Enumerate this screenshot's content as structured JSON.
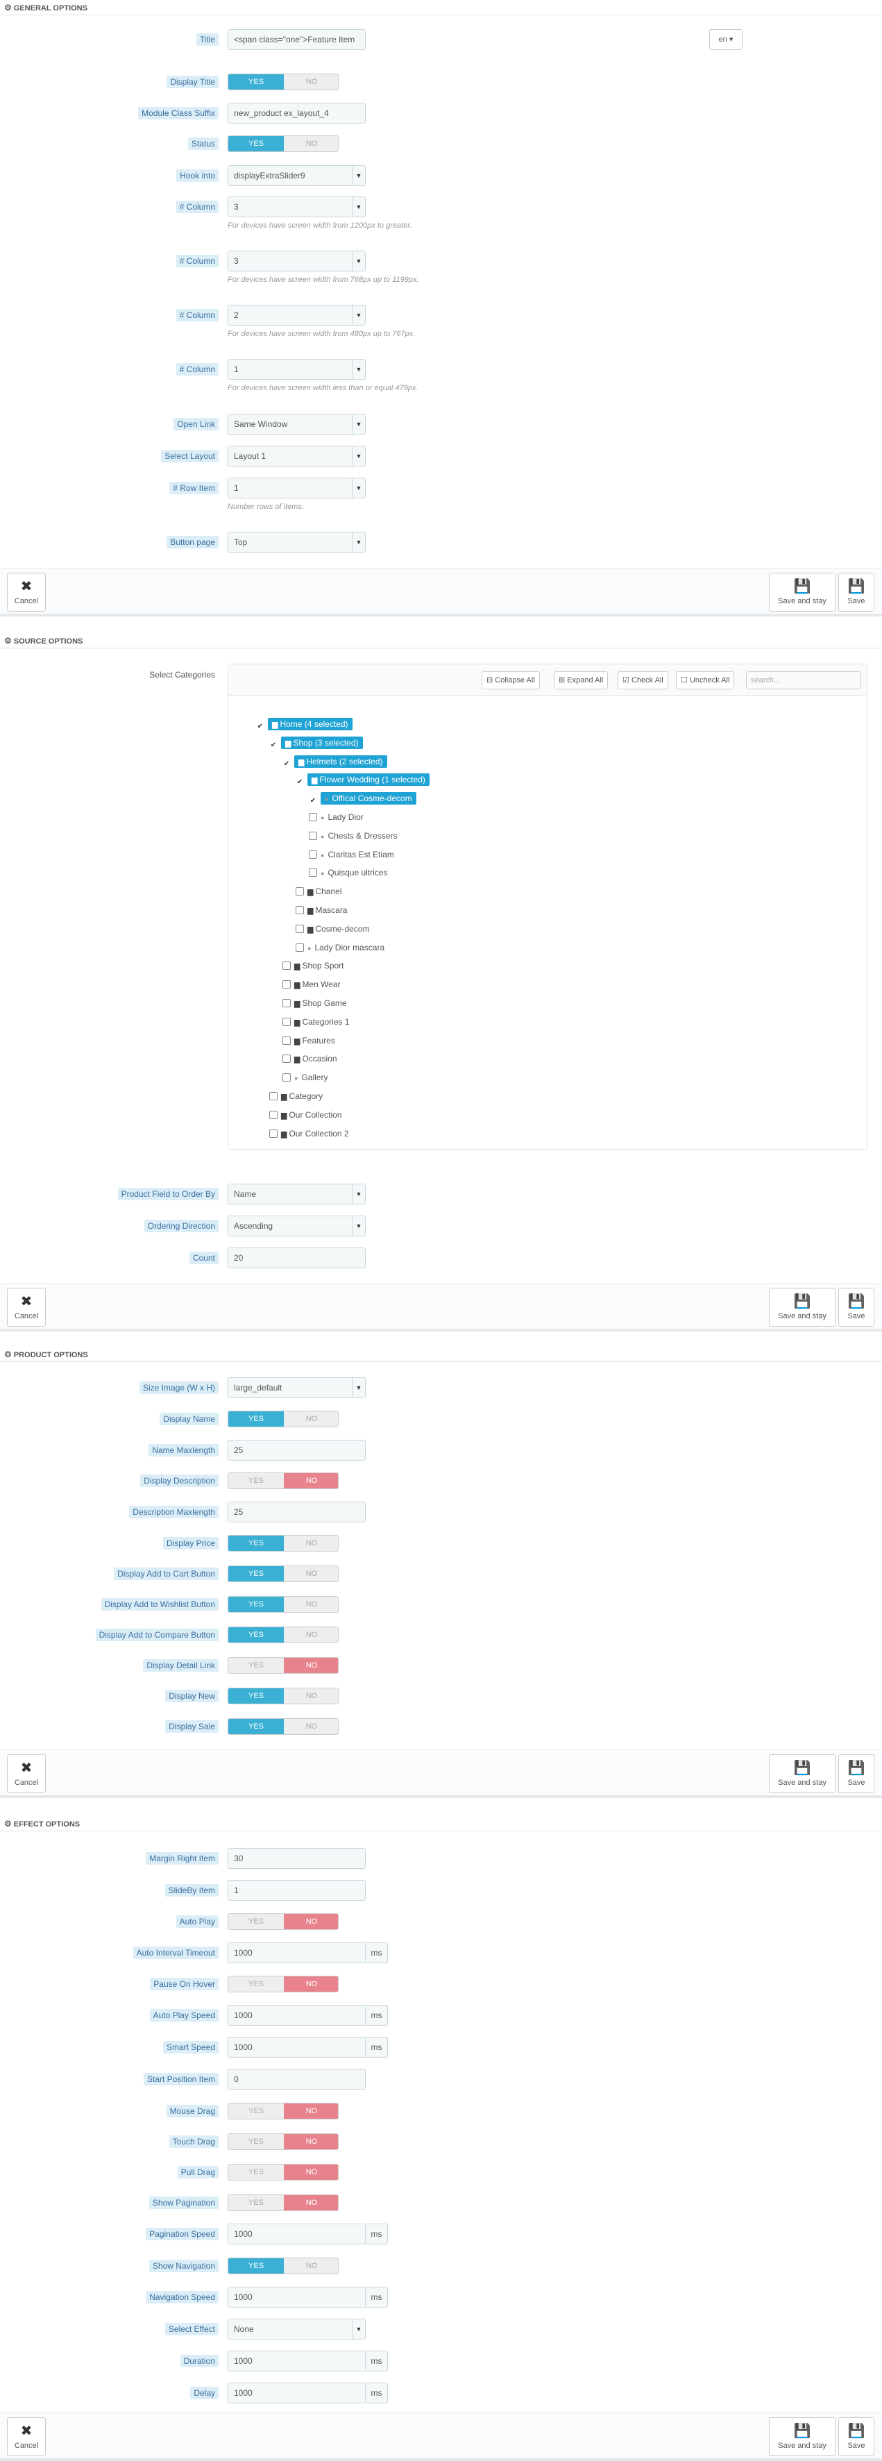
{
  "common": {
    "yes": "YES",
    "no": "NO",
    "cancel": "Cancel",
    "save_and_stay": "Save and stay",
    "save": "Save",
    "ms": "ms",
    "cancel_icon": "close-icon",
    "save_icon": "floppy-icon",
    "cog_icon": "cogs-icon"
  },
  "general": {
    "heading": "GENERAL OPTIONS",
    "title_label": "Title",
    "title_value": "<span class=\"one\">Feature Item",
    "lang": "en",
    "display_title_label": "Display Title",
    "display_title": "yes",
    "suffix_label": "Module Class Suffix",
    "suffix_value": "new_product ex_layout_4",
    "status_label": "Status",
    "status": "yes",
    "hook_label": "Hook into",
    "hook_value": "displayExtraSlider9",
    "column_label": "# Column",
    "col1": "3",
    "col1_help": "For devices have screen width from 1200px to greater.",
    "col2": "3",
    "col2_help": "For devices have screen width from 768px up to 1199px.",
    "col3": "2",
    "col3_help": "For devices have screen width from 480px up to 767px.",
    "col4": "1",
    "col4_help": "For devices have screen width less than or equal 479px.",
    "open_link_label": "Open Link",
    "open_link_value": "Same Window",
    "layout_label": "Select Layout",
    "layout_value": "Layout 1",
    "row_item_label": "# Row Item",
    "row_item_value": "1",
    "row_item_help": "Number rows of items.",
    "button_page_label": "Button page",
    "button_page_value": "Top"
  },
  "source": {
    "heading": "SOURCE OPTIONS",
    "select_categories_label": "Select Categories",
    "collapse_all": "Collapse All",
    "expand_all": "Expand All",
    "check_all": "Check All",
    "uncheck_all": "Uncheck All",
    "search_placeholder": "search...",
    "tree": [
      {
        "label": "Home (4 selected)",
        "depth": 0,
        "checked": true,
        "selected": true,
        "kind": "folder-open"
      },
      {
        "label": "Shop (3 selected)",
        "depth": 1,
        "checked": true,
        "selected": true,
        "kind": "folder-open"
      },
      {
        "label": "Helmets (2 selected)",
        "depth": 2,
        "checked": true,
        "selected": true,
        "kind": "folder-open"
      },
      {
        "label": "Flower Wedding (1 selected)",
        "depth": 3,
        "checked": true,
        "selected": true,
        "kind": "folder-open"
      },
      {
        "label": "Offical Cosme-decom",
        "depth": 4,
        "checked": true,
        "selected": true,
        "kind": "leaf"
      },
      {
        "label": "Lady Dior",
        "depth": 4,
        "checked": false,
        "selected": false,
        "kind": "leaf"
      },
      {
        "label": "Chests & Dressers",
        "depth": 4,
        "checked": false,
        "selected": false,
        "kind": "leaf"
      },
      {
        "label": "Claritas Est Etiam",
        "depth": 4,
        "checked": false,
        "selected": false,
        "kind": "leaf"
      },
      {
        "label": "Quisque ultrices",
        "depth": 4,
        "checked": false,
        "selected": false,
        "kind": "leaf"
      },
      {
        "label": "Chanel",
        "depth": 3,
        "checked": false,
        "selected": false,
        "kind": "folder"
      },
      {
        "label": "Mascara",
        "depth": 3,
        "checked": false,
        "selected": false,
        "kind": "folder"
      },
      {
        "label": "Cosme-decom",
        "depth": 3,
        "checked": false,
        "selected": false,
        "kind": "folder"
      },
      {
        "label": "Lady Dior mascara",
        "depth": 3,
        "checked": false,
        "selected": false,
        "kind": "leaf"
      },
      {
        "label": "Shop Sport",
        "depth": 2,
        "checked": false,
        "selected": false,
        "kind": "folder"
      },
      {
        "label": "Men Wear",
        "depth": 2,
        "checked": false,
        "selected": false,
        "kind": "folder"
      },
      {
        "label": "Shop Game",
        "depth": 2,
        "checked": false,
        "selected": false,
        "kind": "folder"
      },
      {
        "label": "Categories 1",
        "depth": 2,
        "checked": false,
        "selected": false,
        "kind": "folder"
      },
      {
        "label": "Features",
        "depth": 2,
        "checked": false,
        "selected": false,
        "kind": "folder"
      },
      {
        "label": "Occasion",
        "depth": 2,
        "checked": false,
        "selected": false,
        "kind": "folder"
      },
      {
        "label": "Gallery",
        "depth": 2,
        "checked": false,
        "selected": false,
        "kind": "leaf"
      },
      {
        "label": "Category",
        "depth": 1,
        "checked": false,
        "selected": false,
        "kind": "folder"
      },
      {
        "label": "Our Collection",
        "depth": 1,
        "checked": false,
        "selected": false,
        "kind": "folder"
      },
      {
        "label": "Our Collection 2",
        "depth": 1,
        "checked": false,
        "selected": false,
        "kind": "folder"
      }
    ],
    "order_by_label": "Product Field to Order By",
    "order_by_value": "Name",
    "direction_label": "Ordering Direction",
    "direction_value": "Ascending",
    "count_label": "Count",
    "count_value": "20"
  },
  "product": {
    "heading": "PRODUCT OPTIONS",
    "size_label": "Size Image (W x H)",
    "size_value": "large_default",
    "display_name_label": "Display Name",
    "display_name": "yes",
    "name_max_label": "Name Maxlength",
    "name_max_value": "25",
    "display_desc_label": "Display Description",
    "display_desc": "no",
    "desc_max_label": "Description Maxlength",
    "desc_max_value": "25",
    "display_price_label": "Display Price",
    "display_price": "yes",
    "add_cart_label": "Display Add to Cart Button",
    "add_cart": "yes",
    "add_wishlist_label": "Display Add to Wishlist Button",
    "add_wishlist": "yes",
    "add_compare_label": "Display Add to Compare Button",
    "add_compare": "yes",
    "detail_link_label": "Display Detail Link",
    "detail_link": "no",
    "display_new_label": "Display New",
    "display_new": "yes",
    "display_sale_label": "Display Sale",
    "display_sale": "yes"
  },
  "effect": {
    "heading": "EFFECT OPTIONS",
    "margin_label": "Margin Right Item",
    "margin_value": "30",
    "slideby_label": "SlideBy Item",
    "slideby_value": "1",
    "autoplay_label": "Auto Play",
    "autoplay": "no",
    "interval_label": "Auto Interval Timeout",
    "interval_value": "1000",
    "pause_label": "Pause On Hover",
    "pause": "no",
    "autoplay_speed_label": "Auto Play Speed",
    "autoplay_speed_value": "1000",
    "smart_speed_label": "Smart Speed",
    "smart_speed_value": "1000",
    "start_pos_label": "Start Position Item",
    "start_pos_value": "0",
    "mouse_drag_label": "Mouse Drag",
    "mouse_drag": "no",
    "touch_drag_label": "Touch Drag",
    "touch_drag": "no",
    "pull_drag_label": "Pull Drag",
    "pull_drag": "no",
    "show_pagination_label": "Show Pagination",
    "show_pagination": "no",
    "pagination_speed_label": "Pagination Speed",
    "pagination_speed_value": "1000",
    "show_navigation_label": "Show Navigation",
    "show_navigation": "yes",
    "navigation_speed_label": "Navigation Speed",
    "navigation_speed_value": "1000",
    "select_effect_label": "Select Effect",
    "select_effect_value": "None",
    "duration_label": "Duration",
    "duration_value": "1000",
    "delay_label": "Delay",
    "delay_value": "1000"
  }
}
